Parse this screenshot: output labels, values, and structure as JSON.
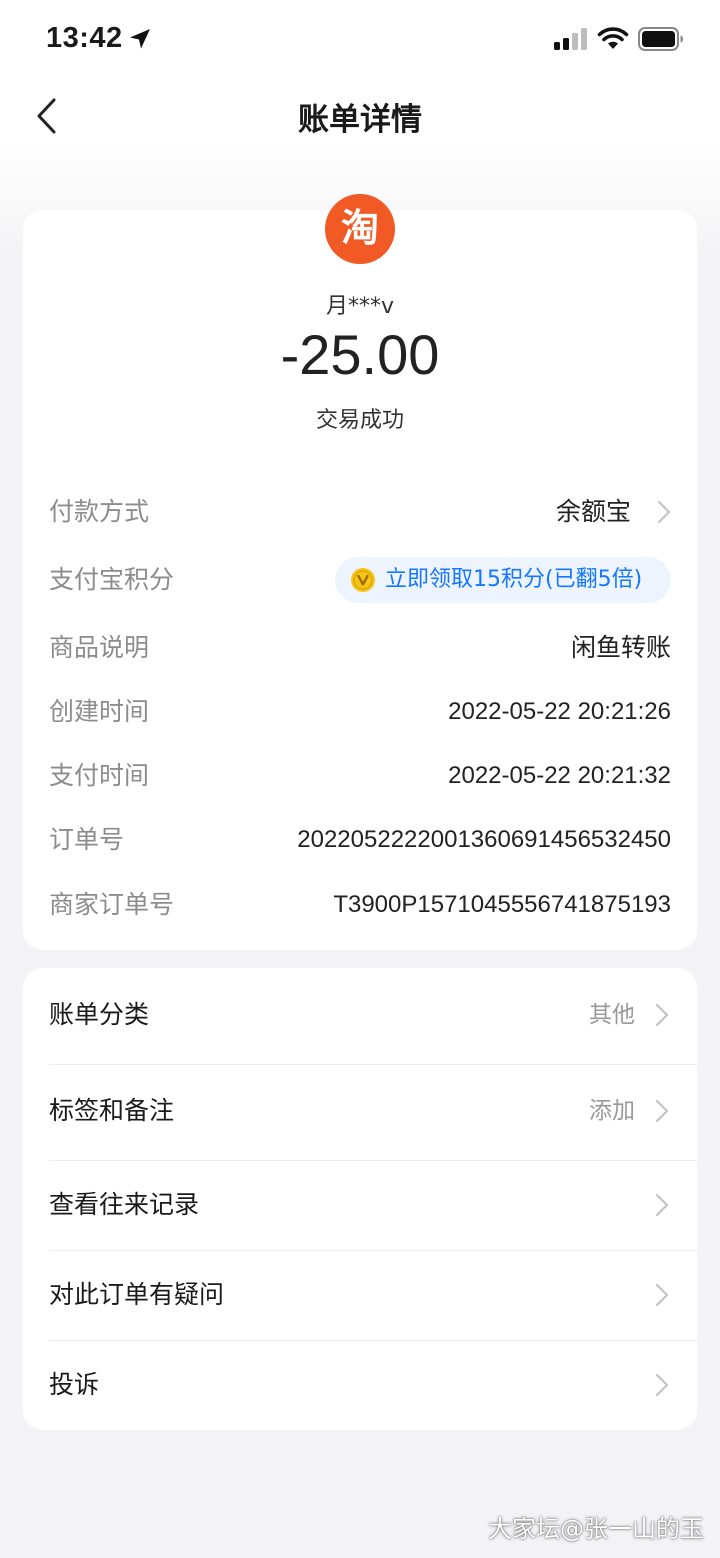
{
  "status_bar": {
    "time": "13:42",
    "icons": [
      "location-arrow-icon",
      "cellular-signal-icon",
      "wifi-icon",
      "battery-icon"
    ]
  },
  "nav": {
    "title": "账单详情",
    "back_icon": "chevron-left-icon"
  },
  "summary": {
    "logo_char": "淘",
    "logo_color": "#f15a24",
    "payee": "月***v",
    "amount": "-25.00",
    "status": "交易成功"
  },
  "details": [
    {
      "label": "付款方式",
      "value": "余额宝"
    },
    {
      "label": "支付宝积分",
      "value": "立即领取15积分(已翻5倍)"
    },
    {
      "label": "商品说明",
      "value": "闲鱼转账"
    },
    {
      "label": "创建时间",
      "value": "2022-05-22 20:21:26"
    },
    {
      "label": "支付时间",
      "value": "2022-05-22 20:21:32"
    },
    {
      "label": "订单号",
      "value": "2022052222001360691456532450"
    },
    {
      "label": "商家订单号",
      "value": "T3900P1571045556741875193"
    }
  ],
  "menu": [
    {
      "label": "账单分类",
      "value": "其他"
    },
    {
      "label": "标签和备注",
      "value": "添加"
    },
    {
      "label": "查看往来记录",
      "value": ""
    },
    {
      "label": "对此订单有疑问",
      "value": ""
    },
    {
      "label": "投诉",
      "value": ""
    }
  ],
  "colors": {
    "accent_blue": "#1677ff",
    "points_bg": "#eef4fd",
    "coin_gold": "#f5c518"
  },
  "watermark": "大家坛@张一山的玉"
}
